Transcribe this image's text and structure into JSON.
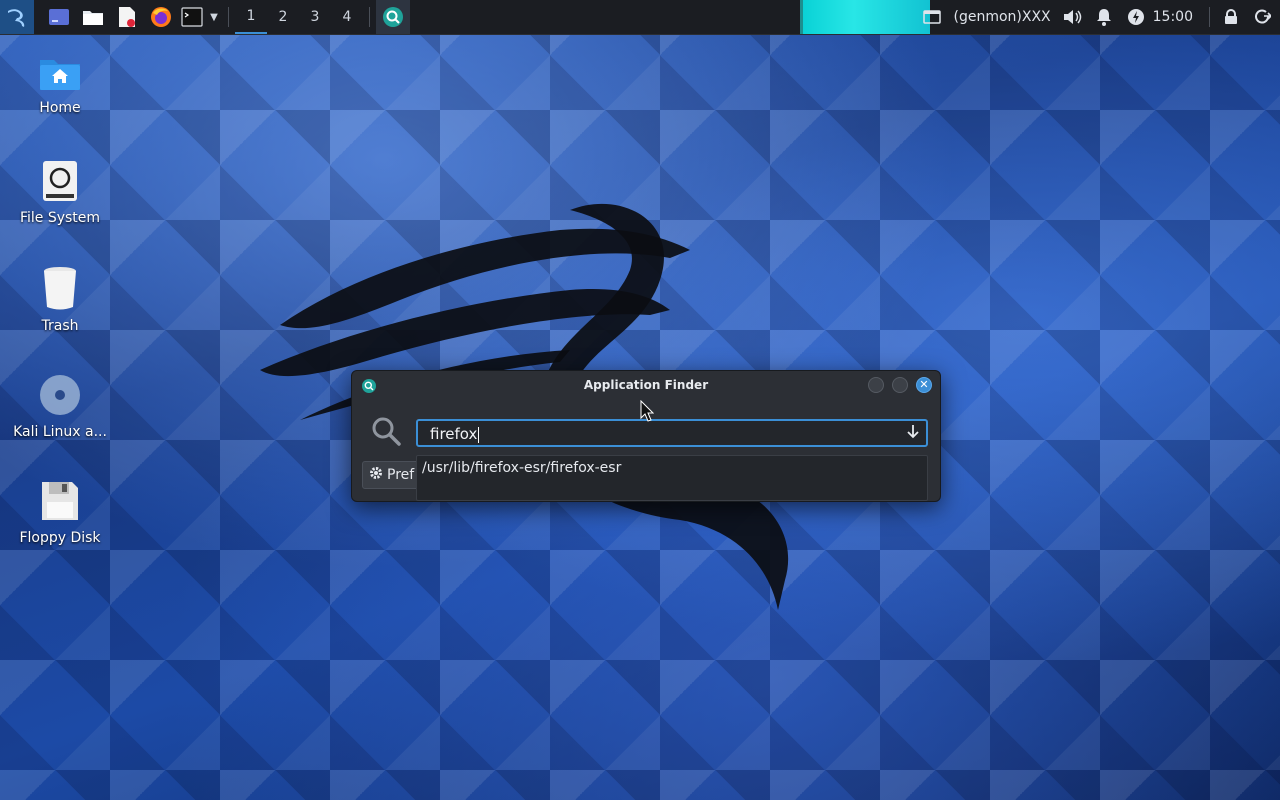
{
  "panel": {
    "workspaces": [
      "1",
      "2",
      "3",
      "4"
    ],
    "active_workspace": "1",
    "genmon_label": "(genmon)XXX",
    "clock": "15:00",
    "accent": "#3b8fd6"
  },
  "desktop": {
    "icons": [
      {
        "label": "Home"
      },
      {
        "label": "File System"
      },
      {
        "label": "Trash"
      },
      {
        "label": "Kali Linux a..."
      },
      {
        "label": "Floppy Disk"
      }
    ]
  },
  "dialog": {
    "title": "Application Finder",
    "search_value": "firefox",
    "suggestion": "/usr/lib/firefox-esr/firefox-esr",
    "preferences_label": "Pref"
  }
}
